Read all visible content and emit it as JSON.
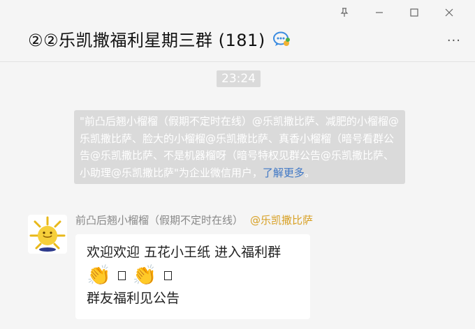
{
  "window": {
    "pin_glyph": "⊥",
    "minimize_glyph": "—",
    "maximize_glyph": "☐",
    "close_glyph": "✕"
  },
  "header": {
    "title": "②②乐凯撒福利星期三群 (181)",
    "more_glyph": "···",
    "badge_icon": "chat-bubble-icon"
  },
  "chat": {
    "timestamp": "23:24",
    "system_notice": {
      "text": "\"前凸后翘小榴榴（假期不定时在线）@乐凯撒比萨、减肥的小榴榴@乐凯撒比萨、脸大的小榴榴@乐凯撒比萨、真香小榴榴（暗号看群公告@乐凯撒比萨、不是机器榴呀（暗号特权见群公告@乐凯撒比萨、小助理@乐凯撒比萨\"为企业微信用户，",
      "link_text": "了解更多",
      "tail": "。"
    },
    "message": {
      "sender_name": "前凸后翘小榴榴（假期不定时在线）",
      "sender_tag": "@乐凯撒比萨",
      "line1": "欢迎欢迎 五花小王纸 进入福利群",
      "clap_emoji": "👏",
      "line3": "群友福利见公告"
    }
  },
  "colors": {
    "background": "#f5f5f5",
    "notice_bg": "#dadada",
    "link": "#3f77c5",
    "tag": "#d8a024"
  }
}
